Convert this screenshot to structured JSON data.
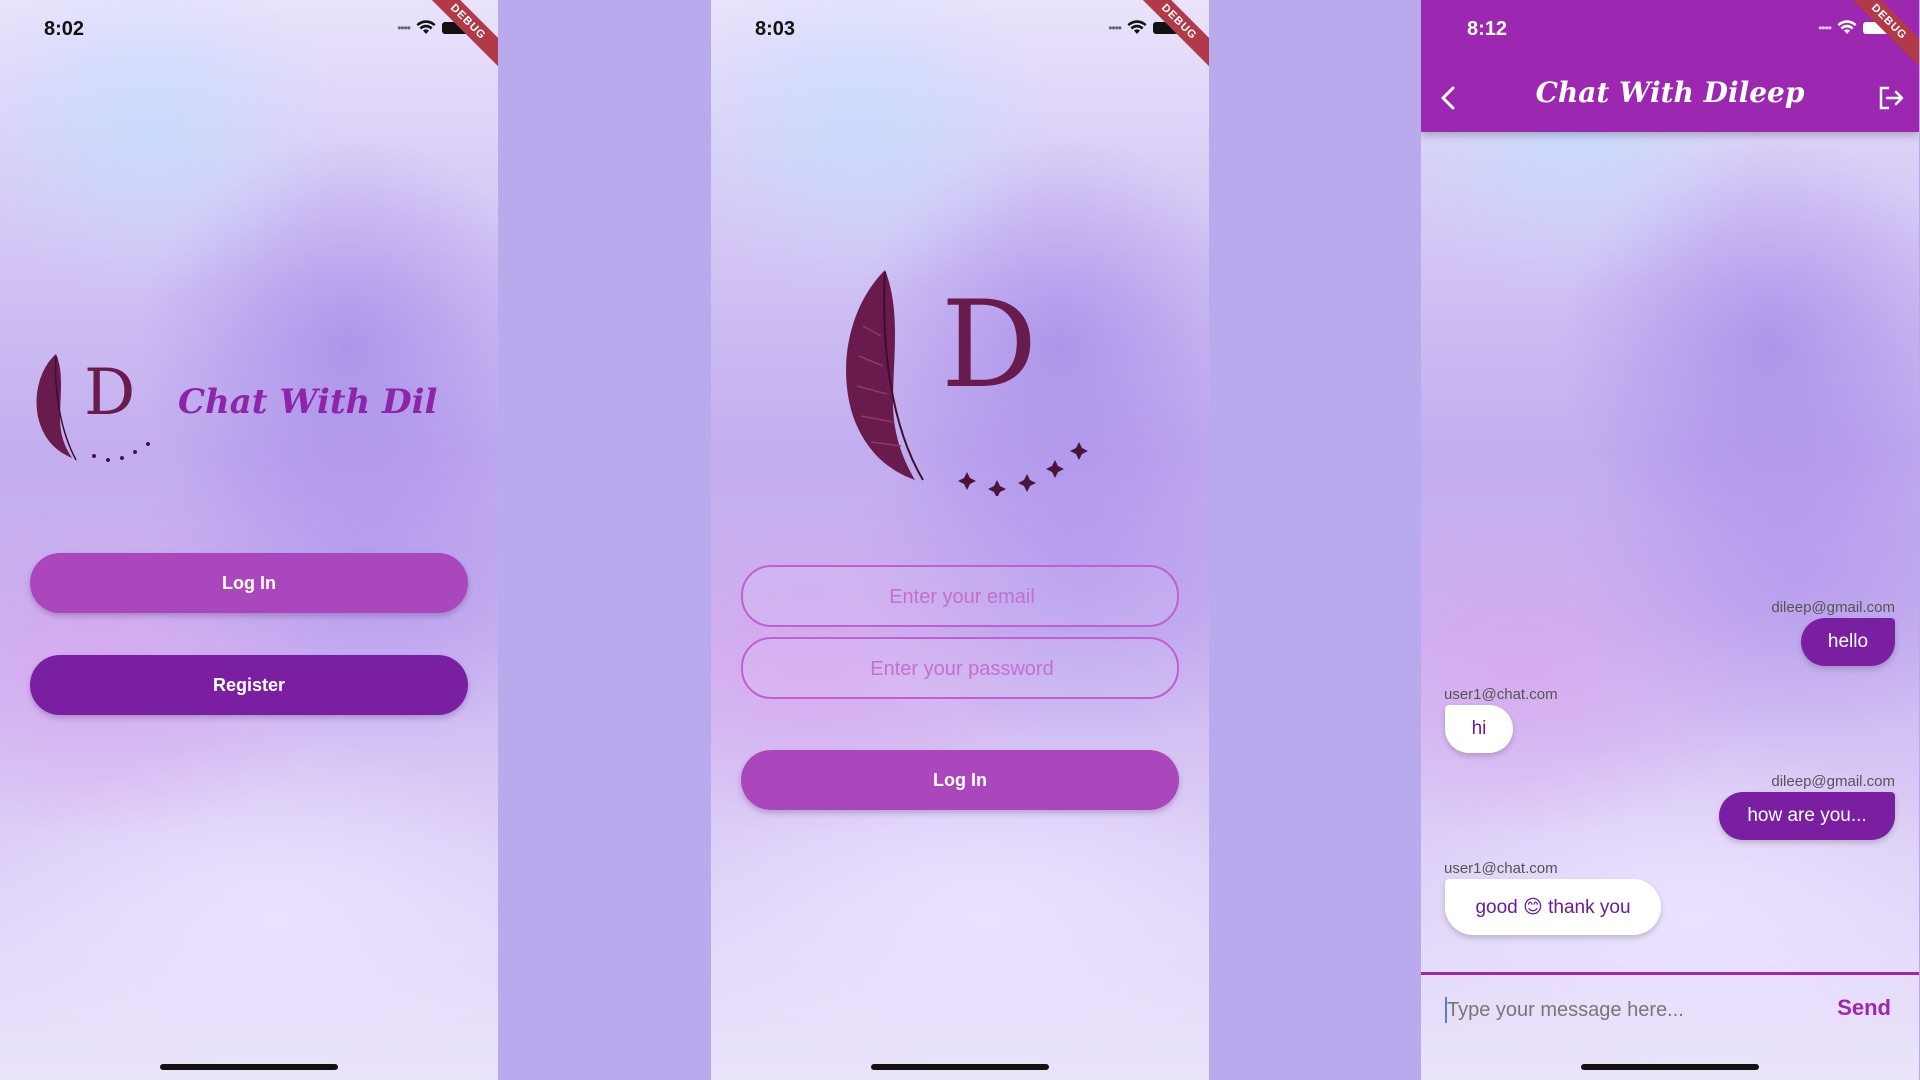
{
  "colors": {
    "gap_background": "#b9aaee",
    "primary": "#9c27b0",
    "button_light": "#ab47bc",
    "button_dark": "#7b1fa2",
    "logo": "#6a1b4d"
  },
  "debug_label": "DEBUG",
  "welcome": {
    "status_time": "8:02",
    "logo_letter": "D",
    "app_name": "Chat With Dil",
    "login_label": "Log In",
    "register_label": "Register"
  },
  "login": {
    "status_time": "8:03",
    "logo_letter": "D",
    "email_placeholder": "Enter your email",
    "password_placeholder": "Enter your password",
    "login_label": "Log In"
  },
  "chat": {
    "status_time": "8:12",
    "title": "Chat With Dileep",
    "messages": [
      {
        "sender": "dileep@gmail.com",
        "text": "hello",
        "mine": true
      },
      {
        "sender": "user1@chat.com",
        "text": "hi",
        "mine": false
      },
      {
        "sender": "dileep@gmail.com",
        "text": "how are you...",
        "mine": true
      },
      {
        "sender": "user1@chat.com",
        "text": "good 😊 thank you",
        "mine": false
      }
    ],
    "input_placeholder": "Type your message here...",
    "send_label": "Send"
  }
}
